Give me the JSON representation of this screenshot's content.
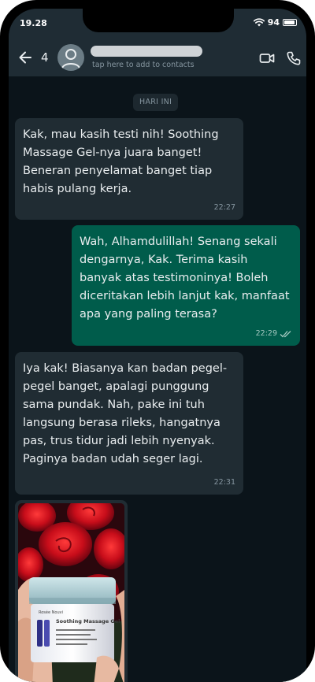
{
  "status_bar": {
    "time": "19.28",
    "battery": "94",
    "battery_level": 0.94,
    "wifi_icon": "wifi-icon",
    "battery_icon": "battery-icon"
  },
  "header": {
    "back_icon": "arrow-left-icon",
    "unread_count": "4",
    "avatar_icon": "person-avatar-icon",
    "subtitle": "tap here to add to contacts",
    "video_icon": "video-call-icon",
    "call_icon": "phone-call-icon"
  },
  "chat": {
    "date_chip": "HARI INI",
    "messages": [
      {
        "direction": "incoming",
        "text": "Kak, mau kasih testi nih! Soothing Massage Gel-nya juara banget! Beneran penyelamat banget tiap habis pulang kerja.",
        "time": "22:27"
      },
      {
        "direction": "outgoing",
        "text": "Wah, Alhamdulillah! Senang sekali dengarnya, Kak. Terima kasih banyak atas testimoninya! Boleh diceritakan lebih lanjut kak, manfaat apa yang paling terasa?",
        "time": "22:29",
        "status_icon": "double-check-icon"
      },
      {
        "direction": "incoming",
        "text": "Iya kak! Biasanya kan badan pegel-pegel banget, apalagi punggung sama pundak. Nah, pake ini tuh langsung berasa rileks, hangatnya pas, trus tidur jadi lebih nyenyak. Paginya badan udah seger lagi.",
        "time": "22:31"
      }
    ],
    "image_message": {
      "direction": "incoming",
      "product_brand": "Rosée Nouvi",
      "product_name": "Soothing Massage Gel"
    }
  },
  "colors": {
    "header_bg": "#1f2c34",
    "chat_bg": "#0b141a",
    "incoming_bubble": "#202c33",
    "outgoing_bubble": "#005c4b",
    "meta_text": "#8696a0"
  }
}
